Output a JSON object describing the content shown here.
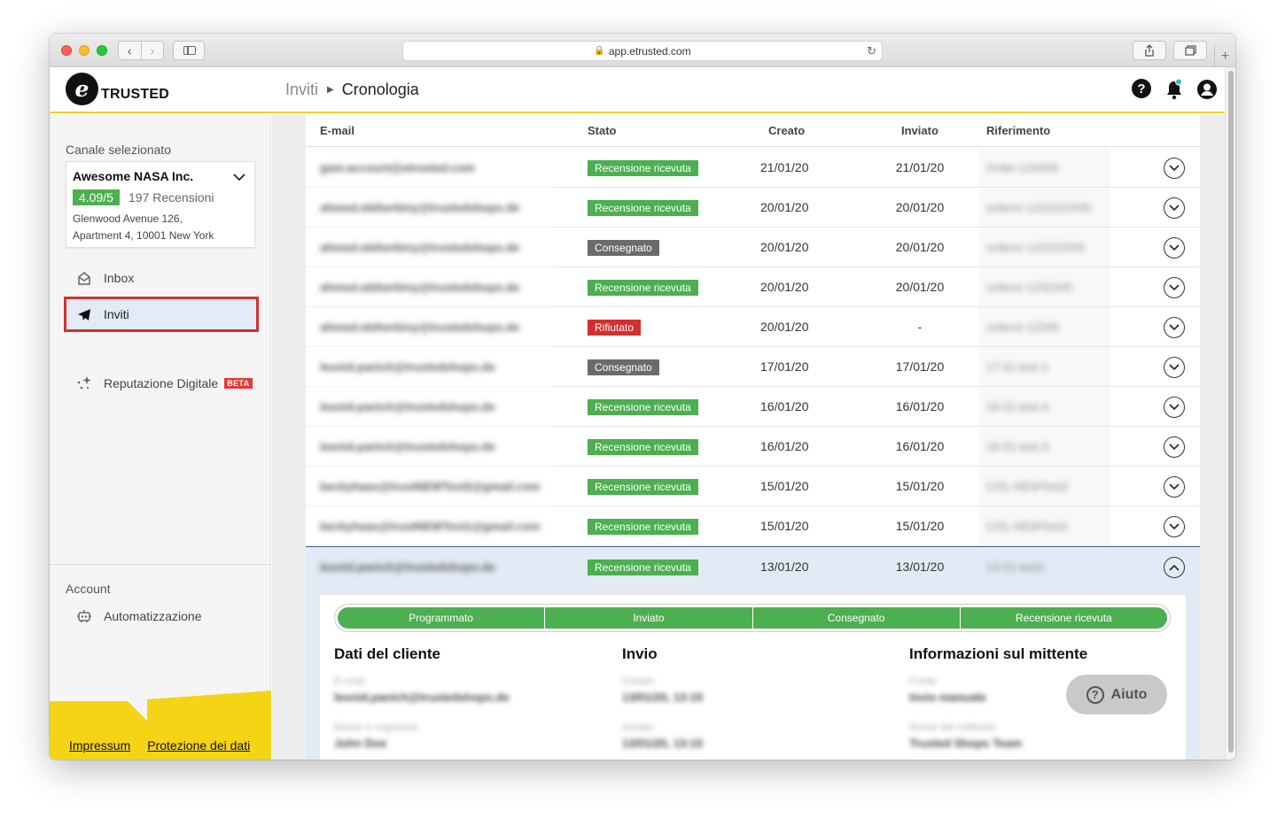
{
  "browser": {
    "url": "app.etrusted.com"
  },
  "header": {
    "logo_letter": "e",
    "logo_text": "TRUSTED",
    "breadcrumb_parent": "Inviti",
    "breadcrumb_current": "Cronologia",
    "help_glyph": "?"
  },
  "sidebar": {
    "channel_label": "Canale selezionato",
    "channel": {
      "name": "Awesome NASA Inc.",
      "score": "4.09/5",
      "reviews": "197 Recensioni",
      "address_line1": "Glenwood Avenue 126,",
      "address_line2": "Apartment 4, 10001 New York"
    },
    "nav": [
      {
        "label": "Inbox",
        "icon": "inbox-icon"
      },
      {
        "label": "Inviti",
        "icon": "paper-plane-icon",
        "active": true
      },
      {
        "label": "Reputazione Digitale",
        "icon": "sparkle-icon",
        "badge": "BETA"
      }
    ],
    "account_label": "Account",
    "account_nav": [
      {
        "label": "Automatizzazione",
        "icon": "robot-icon"
      }
    ],
    "footer_links": [
      "Impressum",
      "Protezione dei dati"
    ]
  },
  "table": {
    "columns": [
      "E-mail",
      "Stato",
      "Creato",
      "Inviato",
      "Riferimento"
    ],
    "rows": [
      {
        "email": "gast.account@etrusted.com",
        "status": "Recensione ricevuta",
        "status_color": "green",
        "created": "21/01/20",
        "sent": "21/01/20",
        "ref": "Order-123456"
      },
      {
        "email": "ahmed.ebiherbiny@trustedshops.de",
        "status": "Recensione ricevuta",
        "status_color": "green",
        "created": "20/01/20",
        "sent": "20/01/20",
        "ref": "ordernr-1222222345"
      },
      {
        "email": "ahmed.ebiherbiny@trustedshops.de",
        "status": "Consegnato",
        "status_color": "gray",
        "created": "20/01/20",
        "sent": "20/01/20",
        "ref": "ordernr-122222345"
      },
      {
        "email": "ahmed.ebiherbiny@trustedshops.de",
        "status": "Recensione ricevuta",
        "status_color": "green",
        "created": "20/01/20",
        "sent": "20/01/20",
        "ref": "ordernr-1232345"
      },
      {
        "email": "ahmed.ebiherbiny@trustedshops.de",
        "status": "Rifiutato",
        "status_color": "red",
        "created": "20/01/20",
        "sent": "-",
        "ref": "ordernr-12345"
      },
      {
        "email": "leonid.panich@trustedshops.de",
        "status": "Consegnato",
        "status_color": "gray",
        "created": "17/01/20",
        "sent": "17/01/20",
        "ref": "17-01-test-1"
      },
      {
        "email": "leonid.panich@trustedshops.de",
        "status": "Recensione ricevuta",
        "status_color": "green",
        "created": "16/01/20",
        "sent": "16/01/20",
        "ref": "16-01-test-4"
      },
      {
        "email": "leonid.panich@trustedshops.de",
        "status": "Recensione ricevuta",
        "status_color": "green",
        "created": "16/01/20",
        "sent": "16/01/20",
        "ref": "16-01-test-3"
      },
      {
        "email": "beckyhaas@trustNEWTest2@gmail.com",
        "status": "Recensione ricevuta",
        "status_color": "green",
        "created": "15/01/20",
        "sent": "15/01/20",
        "ref": "COL-NEWTest2"
      },
      {
        "email": "beckyhaas@trustNEWTest1@gmail.com",
        "status": "Recensione ricevuta",
        "status_color": "green",
        "created": "15/01/20",
        "sent": "15/01/20",
        "ref": "COL-NEWTest1"
      },
      {
        "email": "leonid.panich@trustedshops.de",
        "status": "Recensione ricevuta",
        "status_color": "green",
        "created": "13/01/20",
        "sent": "13/01/20",
        "ref": "13-01-test2",
        "expanded": true
      }
    ]
  },
  "detail": {
    "steps": [
      "Programmato",
      "Inviato",
      "Consegnato",
      "Recensione ricevuta"
    ],
    "sections": {
      "customer": {
        "title": "Dati del cliente",
        "label1": "E-mail",
        "value1": "leonid.panich@trustedshops.de",
        "label2": "Nome e cognome",
        "value2": "John Doe"
      },
      "sending": {
        "title": "Invio",
        "label1": "Creato",
        "value1": "13/01/20, 13:15",
        "label2": "Inviato",
        "value2": "13/01/20, 13:15"
      },
      "sender": {
        "title": "Informazioni sul mittente",
        "label1": "Fonte",
        "value1": "Invio manuale",
        "label2": "Nome del mittente",
        "value2": "Trusted Shops Team"
      }
    }
  },
  "help_widget": {
    "label": "Aiuto",
    "glyph": "?"
  },
  "colors": {
    "accent_yellow": "#f5d416",
    "status_green": "#4caf50",
    "status_gray": "#6b6b6b",
    "status_red": "#d32f2f",
    "active_nav_bg": "#e3ebf7"
  }
}
